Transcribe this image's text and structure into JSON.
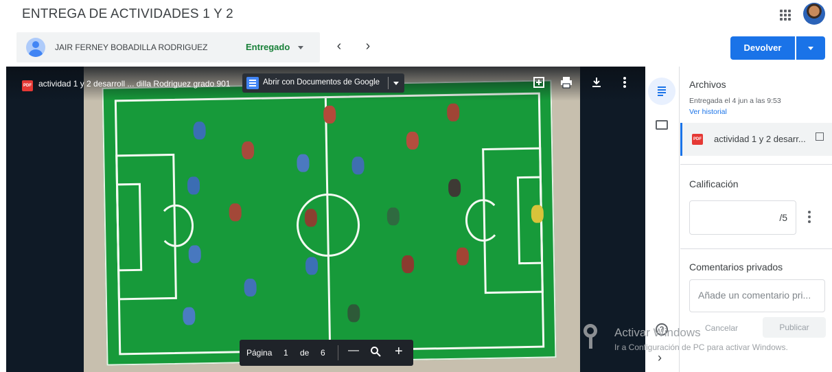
{
  "header": {
    "title": "ENTREGA DE ACTIVIDADES 1 Y 2",
    "apps_icon": "apps-grid-icon",
    "account_icon": "account-avatar"
  },
  "student_bar": {
    "name": "JAIR FERNEY BOBADILLA RODRIGUEZ",
    "status": "Entregado",
    "prev_symbol": "‹",
    "next_symbol": "›"
  },
  "actions": {
    "return_label": "Devolver"
  },
  "viewer": {
    "file_title": "actividad 1 y 2 desarroll ... dilla Rodriguez grado 901",
    "open_with_label": "Abrir con Documentos de Google",
    "pdf_badge": "PDF",
    "toolbar_icons": [
      "add-comment-icon",
      "print-icon",
      "download-icon",
      "more-vert-icon"
    ],
    "pager": {
      "page_label": "Página",
      "current_page": "1",
      "of_label": "de",
      "total_pages": "6",
      "zoom_out_symbol": "—",
      "zoom_in_symbol": "+"
    }
  },
  "side_panel": {
    "files_title": "Archivos",
    "submitted_text": "Entregada el 4 jun a las 9:53",
    "history_link": "Ver historial",
    "file_name": "actividad 1 y 2 desarr...",
    "grade_title": "Calificación",
    "grade_max": "/5",
    "comments_title": "Comentarios privados",
    "comment_placeholder": "Añade un comentario pri...",
    "cancel_label": "Cancelar",
    "publish_label": "Publicar"
  },
  "watermark": {
    "title": "Activar Windows",
    "subtitle": "Ir a Configuración de PC para activar Windows."
  },
  "colors": {
    "accent": "#1a73e8",
    "submitted_green": "#188038",
    "pdf_red": "#e53935",
    "field_green": "#179a3a"
  }
}
